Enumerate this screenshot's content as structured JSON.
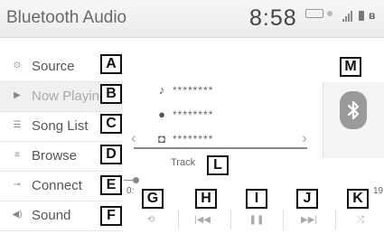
{
  "header": {
    "title": "Bluetooth Audio",
    "clock": "8:58"
  },
  "sidebar": {
    "items": [
      {
        "label": "Source",
        "callout": "A",
        "icon": "source-icon"
      },
      {
        "label": "Now Playing",
        "callout": "B",
        "icon": "now-playing-icon"
      },
      {
        "label": "Song List",
        "callout": "C",
        "icon": "song-list-icon"
      },
      {
        "label": "Browse",
        "callout": "D",
        "icon": "browse-icon"
      },
      {
        "label": "Connect",
        "callout": "E",
        "icon": "connect-icon"
      },
      {
        "label": "Sound",
        "callout": "F",
        "icon": "speaker-icon"
      }
    ]
  },
  "track_info": {
    "song": "********",
    "artist": "********",
    "album": "********",
    "track_label": "Track"
  },
  "progress": {
    "start": "0:",
    "end": "19"
  },
  "controls": [
    {
      "name": "repeat",
      "callout": "G",
      "icon": "repeat-icon"
    },
    {
      "name": "previous",
      "callout": "H",
      "icon": "previous-track-icon"
    },
    {
      "name": "pause",
      "callout": "I",
      "icon": "pause-icon"
    },
    {
      "name": "next",
      "callout": "J",
      "icon": "next-track-icon"
    },
    {
      "name": "shuffle",
      "callout": "K",
      "icon": "shuffle-icon"
    }
  ],
  "callouts": {
    "track": "L",
    "art": "M"
  }
}
